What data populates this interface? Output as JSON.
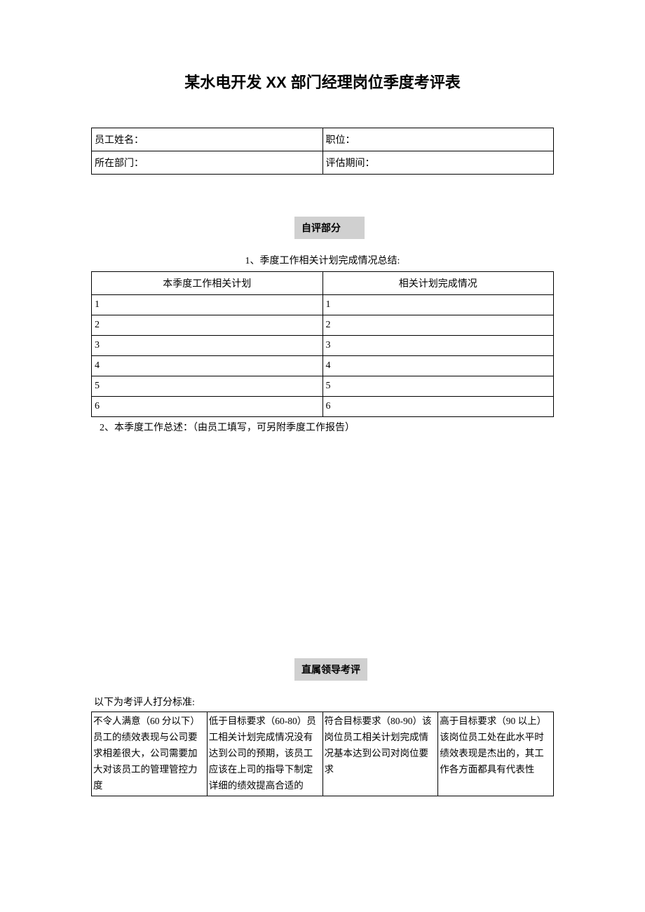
{
  "title": "某水电开发 XX 部门经理岗位季度考评表",
  "info": {
    "name_label": "员工姓名：",
    "position_label": "职位：",
    "department_label": "所在部门：",
    "period_label": "评估期间："
  },
  "section1": {
    "header": "自评部分",
    "sub_heading": "1、季度工作相关计划完成情况总结:",
    "plan_col1": "本季度工作相关计划",
    "plan_col2": "相关计划完成情况",
    "rows": [
      {
        "left": "1",
        "right": "1"
      },
      {
        "left": "2",
        "right": "2"
      },
      {
        "left": "3",
        "right": "3"
      },
      {
        "left": "4",
        "right": "4"
      },
      {
        "left": "5",
        "right": "5"
      },
      {
        "left": "6",
        "right": "6"
      }
    ],
    "note": "2、本季度工作总述：（由员工填写，可另附季度工作报告）"
  },
  "section2": {
    "header": "直属领导考评",
    "criteria_intro": "以下为考评人打分标准:",
    "criteria": [
      "不令人满意（60 分以下）员工的绩效表现与公司要求相差很大，公司需要加大对该员工的管理管控力度",
      "低于目标要求（60-80）员工相关计划完成情况没有达到公司的预期，该员工应该在上司的指导下制定详细的绩效提高合适的",
      "符合目标要求（80-90）该岗位员工相关计划完成情 况基本达到公司对岗位要 求",
      "高于目标要求（90 以上）该岗位员工处在此水平时绩效表现是杰出的，其工作各方面都具有代表性"
    ]
  }
}
